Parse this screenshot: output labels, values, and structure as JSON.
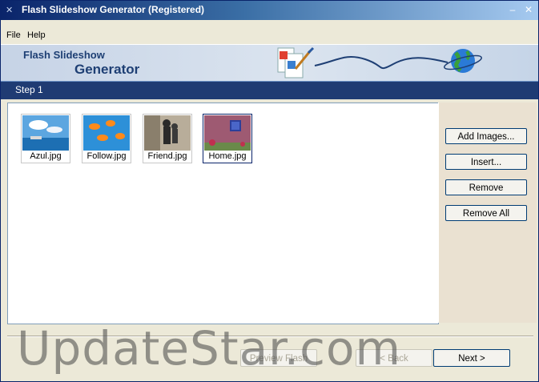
{
  "window": {
    "title": "Flash Slideshow Generator (Registered)"
  },
  "menu": {
    "items": [
      "File",
      "Help"
    ]
  },
  "banner": {
    "line1": "Flash Slideshow",
    "line2": "Generator"
  },
  "step": {
    "label": "Step 1"
  },
  "images": [
    {
      "name": "Azul.jpg"
    },
    {
      "name": "Follow.jpg"
    },
    {
      "name": "Friend.jpg"
    },
    {
      "name": "Home.jpg"
    }
  ],
  "side_buttons": {
    "add_images": "Add Images...",
    "insert": "Insert...",
    "remove": "Remove",
    "remove_all": "Remove All"
  },
  "nav": {
    "preview": "Preview Flash",
    "back": "< Back",
    "next": "Next >"
  },
  "watermark": "UpdateStar.com",
  "colors": {
    "title_bar": "#0a246a",
    "step_bar": "#1f3b73",
    "side_panel": "#eae1d1"
  }
}
